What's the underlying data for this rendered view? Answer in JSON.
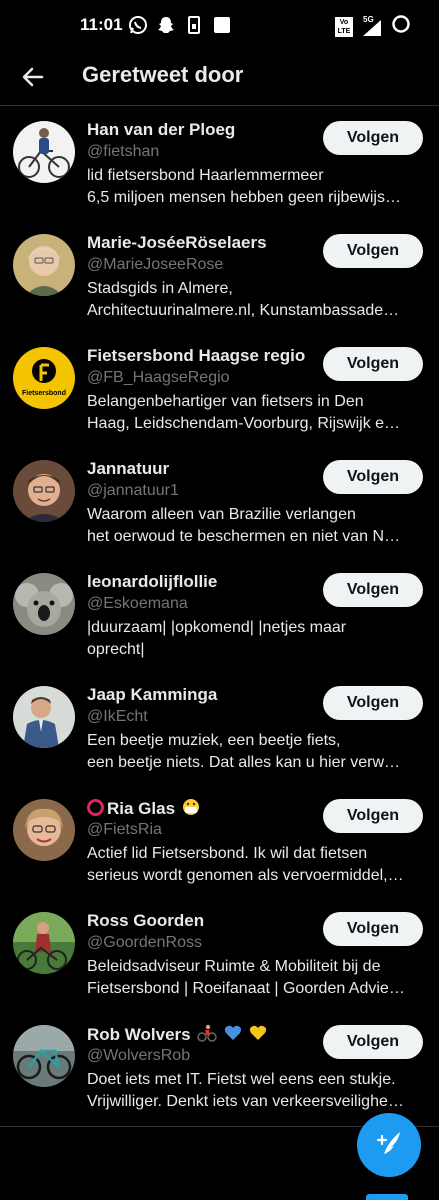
{
  "status_bar": {
    "time": "11:01",
    "left_icons": [
      "whatsapp-icon",
      "snapchat-icon",
      "sim-icon",
      "square-icon"
    ],
    "right_icons": [
      "volte-icon",
      "signal-5g-icon",
      "battery-icon"
    ],
    "network_label": "5G",
    "volte_label": "Vo LTE"
  },
  "header": {
    "title": "Geretweet door",
    "back_icon": "arrow-left-icon"
  },
  "follow_label": "Volgen",
  "users": [
    {
      "name": "Han van der Ploeg",
      "handle": "@fietshan",
      "bio_lines": [
        "lid fietsersbond Haarlemmermeer",
        "6,5 miljoen mensen hebben geen rijbewijs…"
      ]
    },
    {
      "name": "Marie-JoséeRöselaers",
      "handle": "@MarieJoseeRose",
      "bio_lines": [
        "Stadsgids in Almere,",
        "Architectuurinalmere.nl, Kunstambassade…"
      ]
    },
    {
      "name": "Fietsersbond Haagse regio",
      "handle": "@FB_HaagseRegio",
      "bio_lines": [
        "Belangenbehartiger van fietsers in Den",
        "Haag, Leidschendam-Voorburg, Rijswijk e…"
      ],
      "avatar_text": "Fietsersbond"
    },
    {
      "name": "Jannatuur",
      "handle": "@jannatuur1",
      "bio_lines": [
        "Waarom alleen van Brazilie verlangen",
        "het oerwoud te beschermen en niet van N…"
      ]
    },
    {
      "name": "leonardolijflollie",
      "handle": "@Eskoemana",
      "bio_lines": [
        "|duurzaam| |opkomend| |netjes maar",
        "oprecht|"
      ]
    },
    {
      "name": "Jaap Kamminga",
      "handle": "@IkEcht",
      "bio_lines": [
        "Een beetje muziek, een beetje fiets,",
        "een beetje niets. Dat alles kan u hier verw…"
      ]
    },
    {
      "name": "Ria Glas",
      "handle": "@FietsRia",
      "bio_lines": [
        "Actief lid Fietsersbond. Ik wil dat fietsen",
        "serieus wordt genomen als vervoermiddel,…"
      ],
      "name_prefix_emoji": "red-ring-emoji",
      "name_suffix_emoji": "mask-face-emoji"
    },
    {
      "name": "Ross Goorden",
      "handle": "@GoordenRoss",
      "bio_lines": [
        "Beleidsadviseur Ruimte & Mobiliteit bij de",
        "Fietsersbond | Roeifanaat | Goorden Advie…"
      ]
    },
    {
      "name": "Rob Wolvers",
      "handle": "@WolversRob",
      "bio_lines": [
        "Doet iets met IT. Fietst wel eens een stukje.",
        "Vrijwilliger. Denkt iets van verkeersveilighe…"
      ],
      "name_suffix_emoji": "cyclist-blue-heart-yellow-heart-emoji"
    }
  ],
  "fab": {
    "icon": "compose-tweet-icon"
  },
  "colors": {
    "background": "#000000",
    "text_primary": "#e7e9ea",
    "text_secondary": "#71767b",
    "follow_button_bg": "#eff3f4",
    "accent": "#1d9bf0",
    "divider": "#2f3336"
  }
}
